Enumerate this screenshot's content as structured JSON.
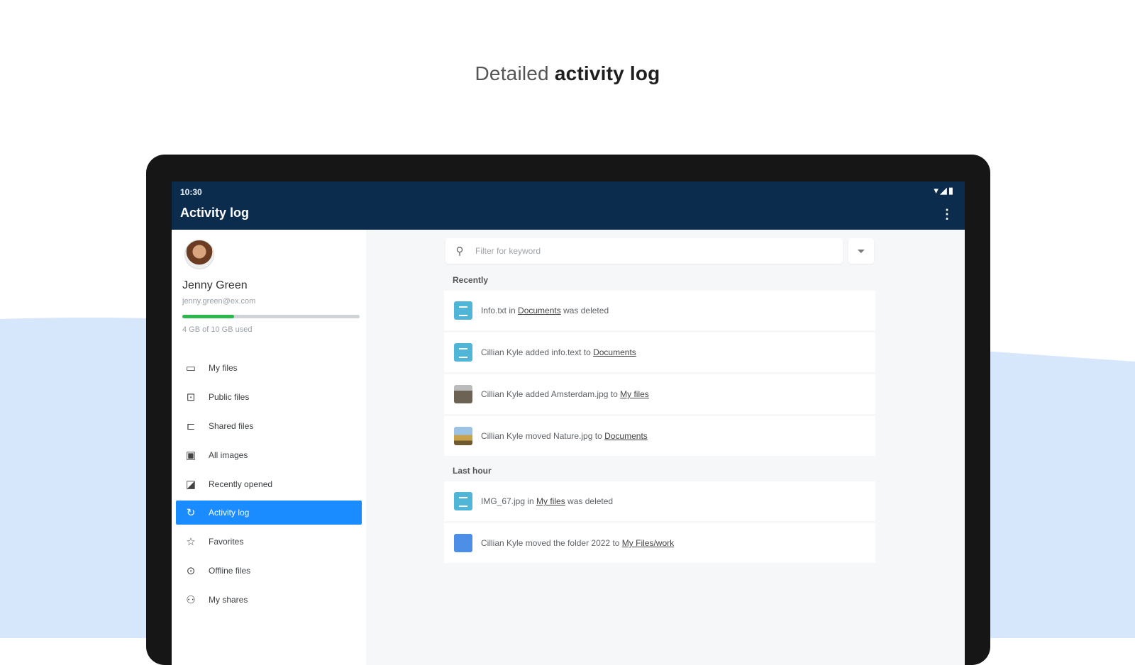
{
  "headline": {
    "light": "Detailed",
    "bold": "activity log"
  },
  "status_bar": {
    "time": "10:30",
    "icons": "▾◢▮"
  },
  "app_bar": {
    "title": "Activity log"
  },
  "user": {
    "name": "Jenny Green",
    "email": "jenny.green@ex.com",
    "storage_text": "4 GB of 10 GB used",
    "storage_fraction": 0.29
  },
  "nav": {
    "items": [
      {
        "label": "My files",
        "icon": "folder-icon"
      },
      {
        "label": "Public files",
        "icon": "public-folder-icon"
      },
      {
        "label": "Shared files",
        "icon": "shared-folder-icon"
      },
      {
        "label": "All images",
        "icon": "image-icon"
      },
      {
        "label": "Recently opened",
        "icon": "recent-file-icon"
      },
      {
        "label": "Activity log",
        "icon": "activity-icon",
        "active": true
      },
      {
        "label": "Favorites",
        "icon": "star-icon"
      },
      {
        "label": "Offline files",
        "icon": "offline-icon"
      },
      {
        "label": "My shares",
        "icon": "shares-icon"
      }
    ]
  },
  "search": {
    "placeholder": "Filter for keyword"
  },
  "sections": {
    "recently": {
      "label": "Recently",
      "rows": [
        {
          "pre": "Info.txt in ",
          "link": "Documents",
          "post": " was deleted"
        },
        {
          "pre": "Cillian Kyle added info.text to ",
          "link": "Documents",
          "post": ""
        },
        {
          "pre": "Cillian Kyle added Amsterdam.jpg to ",
          "link": "My files",
          "post": ""
        },
        {
          "pre": "Cillian Kyle moved Nature.jpg to ",
          "link": "Documents",
          "post": ""
        }
      ]
    },
    "last_hour": {
      "label": "Last hour",
      "rows": [
        {
          "pre": "IMG_67.jpg in ",
          "link": "My files",
          "post": " was deleted"
        },
        {
          "pre": "Cillian Kyle moved the folder 2022 to ",
          "link": "My Files/work",
          "post": ""
        }
      ]
    }
  },
  "colors": {
    "app_bar": "#0c2c4e",
    "accent": "#1a8cff",
    "storage": "#2db84d"
  }
}
